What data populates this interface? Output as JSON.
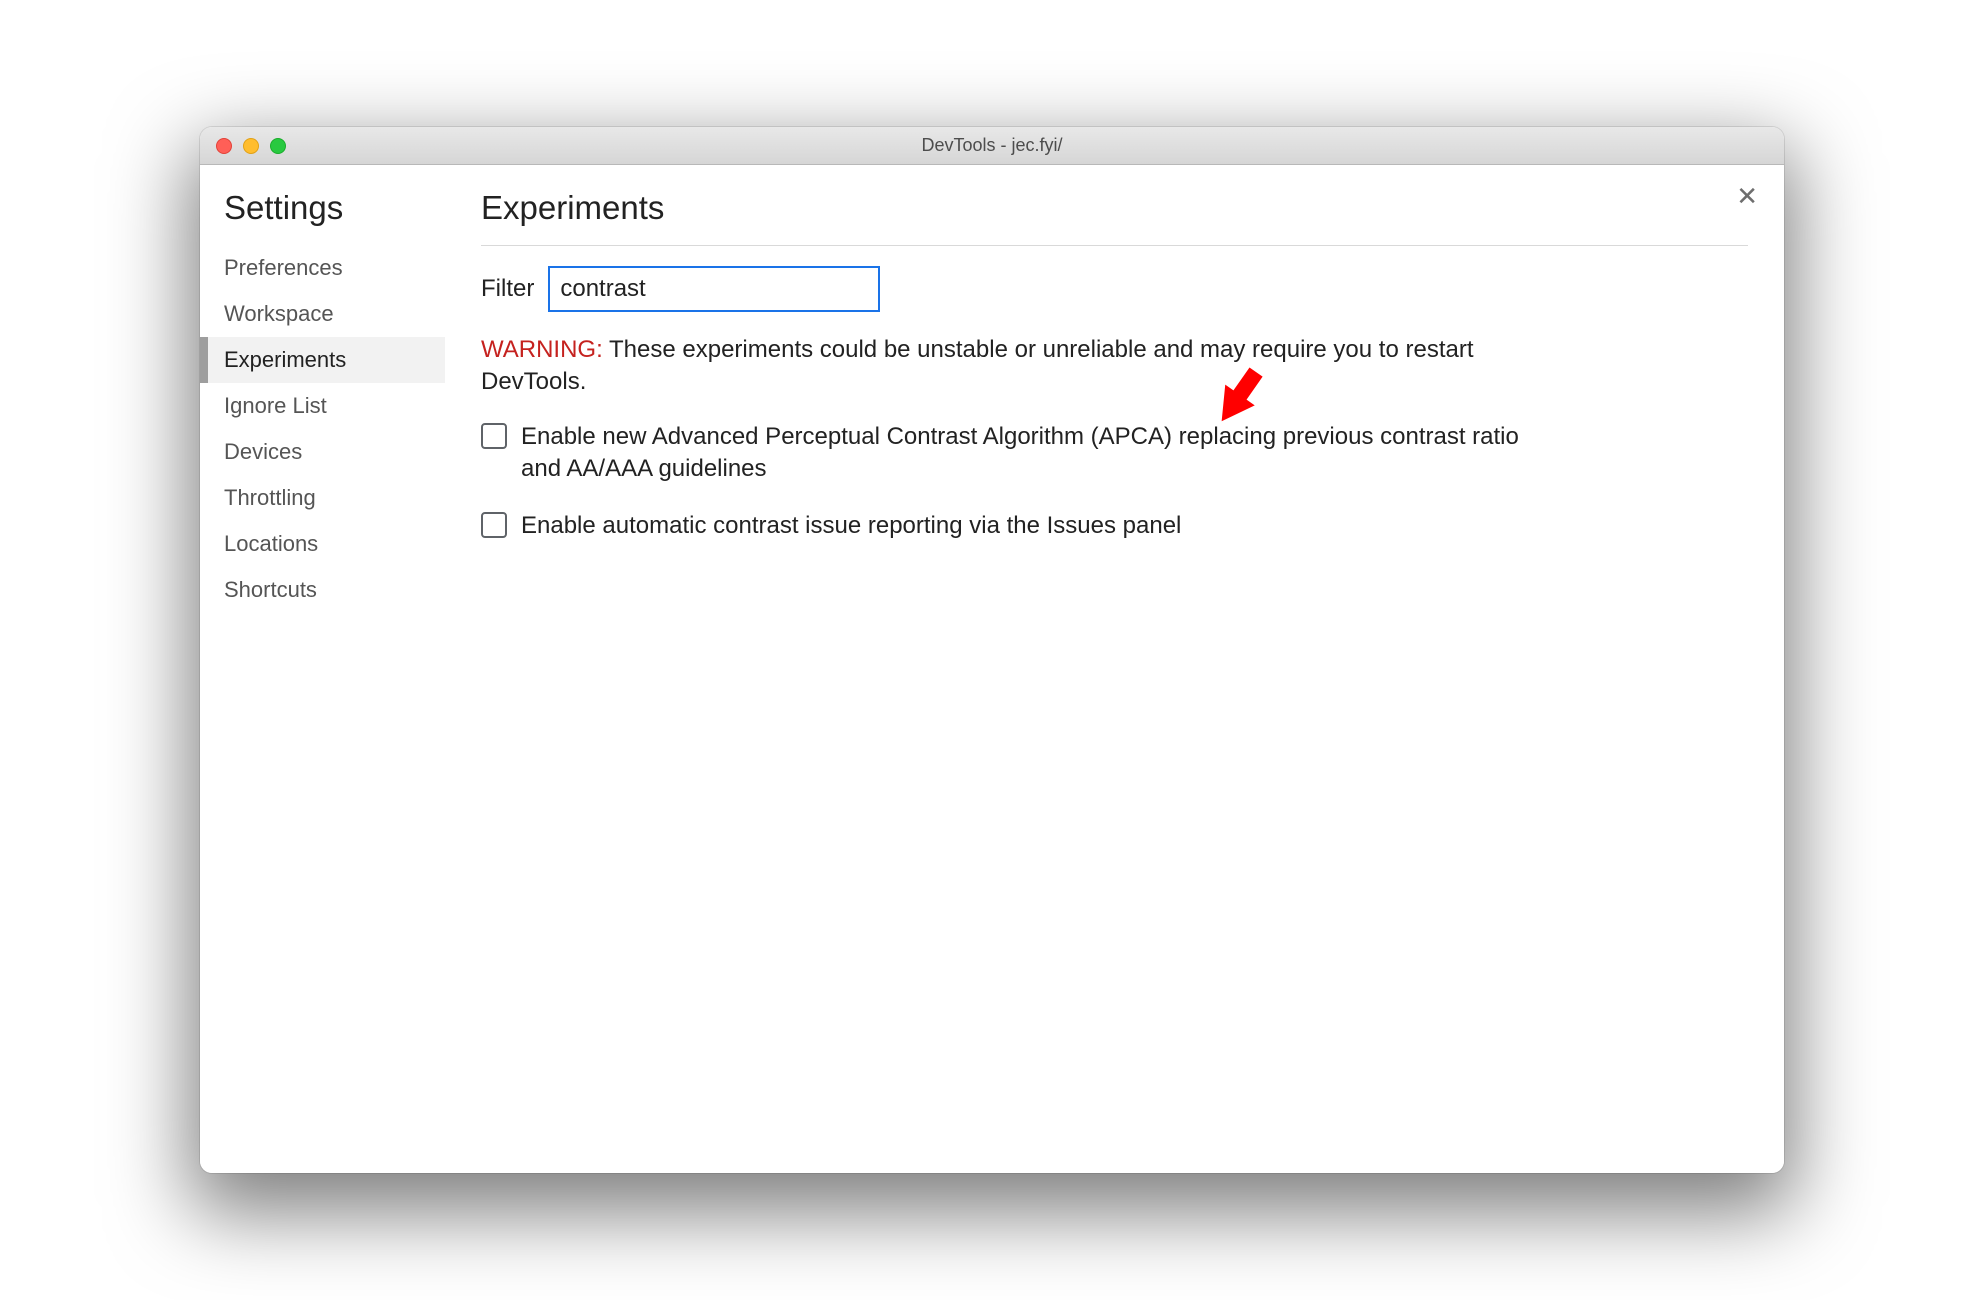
{
  "window": {
    "title": "DevTools - jec.fyi/"
  },
  "sidebar": {
    "title": "Settings",
    "items": [
      {
        "label": "Preferences",
        "active": false
      },
      {
        "label": "Workspace",
        "active": false
      },
      {
        "label": "Experiments",
        "active": true
      },
      {
        "label": "Ignore List",
        "active": false
      },
      {
        "label": "Devices",
        "active": false
      },
      {
        "label": "Throttling",
        "active": false
      },
      {
        "label": "Locations",
        "active": false
      },
      {
        "label": "Shortcuts",
        "active": false
      }
    ]
  },
  "main": {
    "title": "Experiments",
    "filter_label": "Filter",
    "filter_value": "contrast",
    "warning_label": "WARNING:",
    "warning_text": " These experiments could be unstable or unreliable and may require you to restart DevTools.",
    "experiments": [
      {
        "label": "Enable new Advanced Perceptual Contrast Algorithm (APCA) replacing previous contrast ratio and AA/AAA guidelines",
        "checked": false
      },
      {
        "label": "Enable automatic contrast issue reporting via the Issues panel",
        "checked": false
      }
    ]
  },
  "annotation": {
    "arrow_color": "#ff0000"
  }
}
